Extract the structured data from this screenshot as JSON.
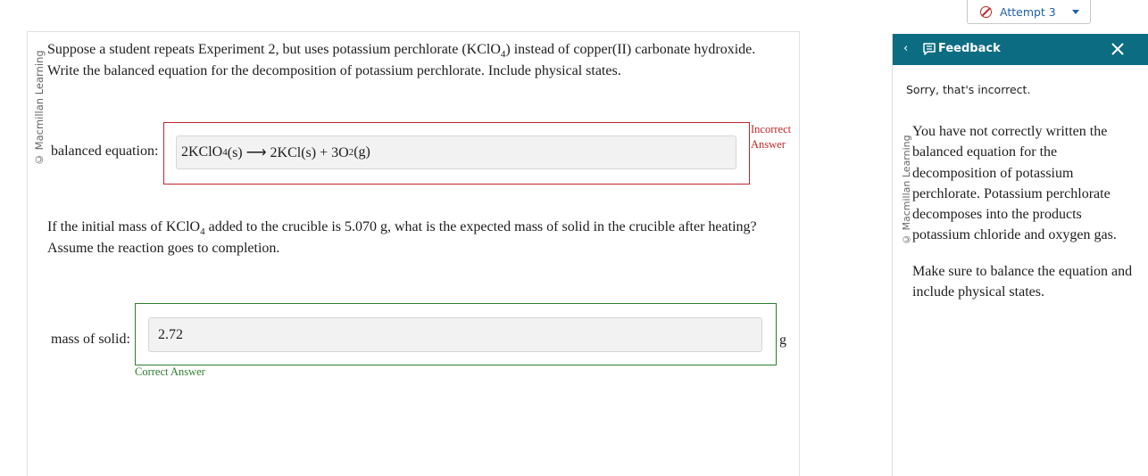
{
  "header": {
    "attempt_label": "Attempt 3"
  },
  "question": {
    "watermark": "© Macmillan Learning",
    "q1_line1_before": "Suppose a student repeats Experiment 2, but uses potassium perchlorate (KClO",
    "q1_line1_sub": "4",
    "q1_line1_after": ") instead of copper(II) carbonate hydroxide.",
    "q1_line2": "Write the balanced equation for the decomposition of potassium perchlorate. Include physical states.",
    "eq_label": "balanced equation:",
    "eq_answer": {
      "part1": "2KClO",
      "sub1": "4",
      "part2": "(s) ⟶ 2KCl(s) + 3O",
      "sub2": "2",
      "part3": "(g)"
    },
    "eq_verdict_line1": "Incorrect",
    "eq_verdict_line2": "Answer",
    "q2_line1_before": "If the initial mass of KClO",
    "q2_line1_sub": "4",
    "q2_line1_after": " added to the crucible is 5.070 g, what is the expected mass of solid in the crucible after heating?",
    "q2_line2": "Assume the reaction goes to completion.",
    "mass_label": "mass of solid:",
    "mass_value": "2.72",
    "mass_unit": "g",
    "mass_verdict": "Correct Answer"
  },
  "feedback": {
    "title": "Feedback",
    "sorry": "Sorry, that's incorrect.",
    "watermark": "© Macmillan Learning",
    "paragraph1": "You have not correctly written the balanced equation for the decomposition of potassium perchlorate. Potassium perchlorate decomposes into the products potassium chloride and oxygen gas.",
    "paragraph2": "Make sure to balance the equation and include physical states."
  },
  "colors": {
    "teal_header": "#0c6d82",
    "incorrect_red": "#c0262a",
    "correct_green": "#2f7d2f",
    "link_blue": "#2060a8"
  }
}
